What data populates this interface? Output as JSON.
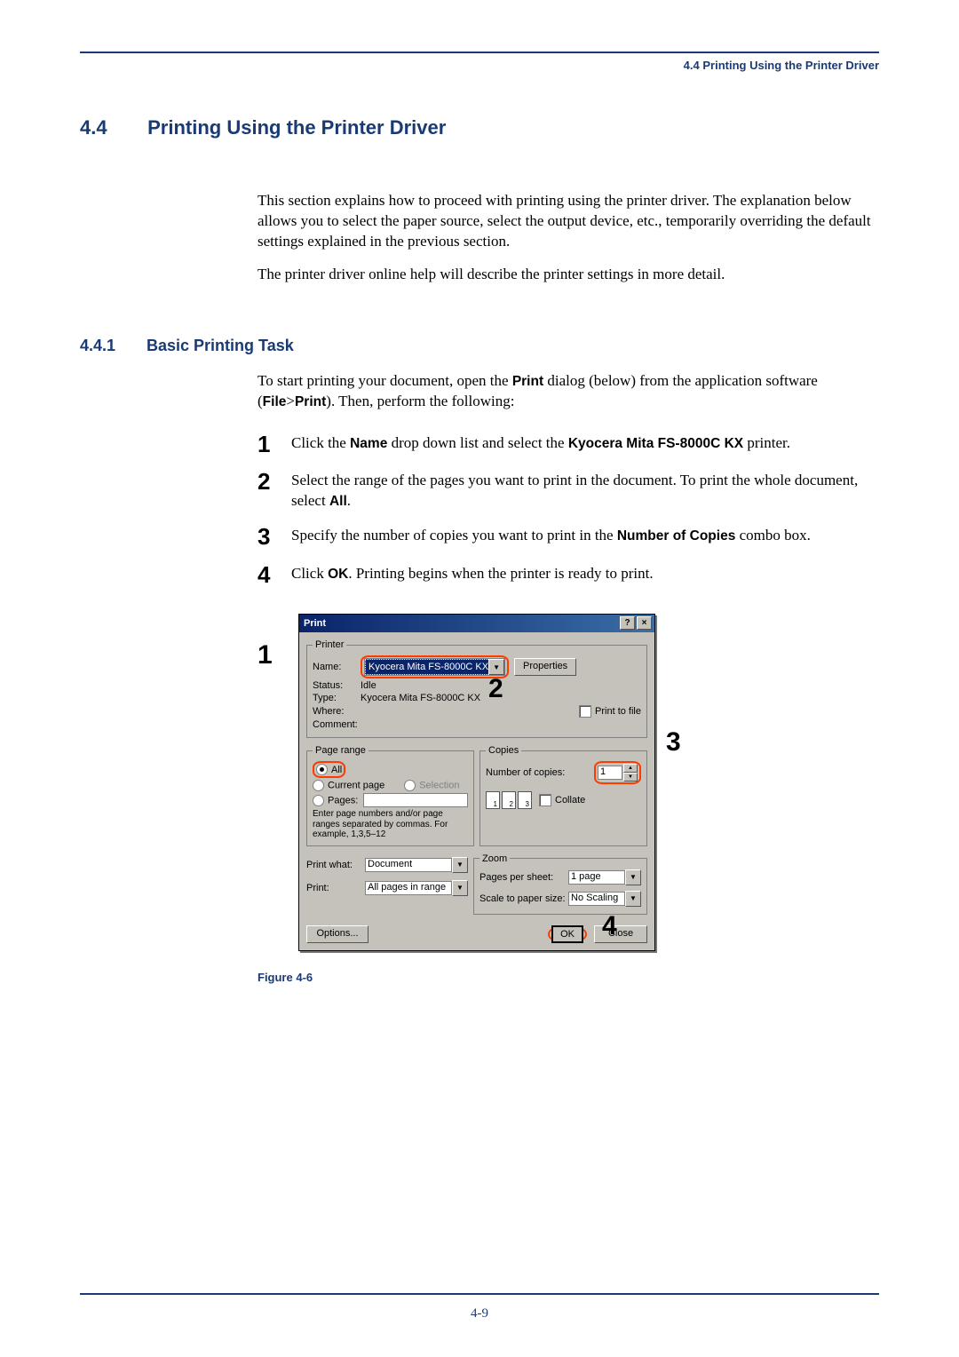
{
  "header_link": "4.4 Printing Using the Printer Driver",
  "section": {
    "number": "4.4",
    "title": "Printing Using the Printer Driver"
  },
  "intro": {
    "p1": "This section explains how to proceed with printing using the printer driver. The explanation below allows you to select the paper source, select the output device, etc., temporarily overriding the default settings explained in the previous section.",
    "p2": "The printer driver online help will describe the printer settings in more detail."
  },
  "subsection": {
    "number": "4.4.1",
    "title": "Basic Printing Task"
  },
  "sub_intro": {
    "pre": "To start printing your document, open the ",
    "b1": "Print",
    "mid1": " dialog (below) from the application software (",
    "b2": "File",
    "gt": ">",
    "b3": "Print",
    "post": "). Then, perform the following:"
  },
  "steps": [
    {
      "n": "1",
      "pre": "Click the ",
      "b1": "Name",
      "mid": " drop down list and select the ",
      "b2": "Kyocera Mita FS-8000C KX",
      "post": " printer."
    },
    {
      "n": "2",
      "pre": "Select the range of the pages you want to print in the document. To print the whole document, select ",
      "b1": "All",
      "post": "."
    },
    {
      "n": "3",
      "pre": "Specify the number of copies you want to print in the ",
      "b1": "Number of Copies",
      "post": " combo box."
    },
    {
      "n": "4",
      "pre": "Click ",
      "b1": "OK",
      "post": ". Printing begins when the printer is ready to print."
    }
  ],
  "dialog": {
    "title": "Print",
    "help": "?",
    "close": "×",
    "printer": {
      "legend": "Printer",
      "name_label": "Name:",
      "name_value": "Kyocera Mita FS-8000C KX",
      "properties": "Properties",
      "status_label": "Status:",
      "status_value": "Idle",
      "type_label": "Type:",
      "type_value": "Kyocera Mita FS-8000C KX",
      "where_label": "Where:",
      "where_value": "",
      "comment_label": "Comment:",
      "comment_value": "",
      "print_to_file": "Print to file"
    },
    "page_range": {
      "legend": "Page range",
      "all": "All",
      "current": "Current page",
      "selection": "Selection",
      "pages": "Pages:",
      "hint": "Enter page numbers and/or page ranges separated by commas. For example, 1,3,5–12"
    },
    "copies": {
      "legend": "Copies",
      "num_label": "Number of copies:",
      "num_value": "1",
      "collate": "Collate"
    },
    "zoom": {
      "legend": "Zoom",
      "pps_label": "Pages per sheet:",
      "pps_value": "1 page",
      "scale_label": "Scale to paper size:",
      "scale_value": "No Scaling"
    },
    "print_what_label": "Print what:",
    "print_what_value": "Document",
    "print_label": "Print:",
    "print_value": "All pages in range",
    "options": "Options...",
    "ok": "OK",
    "close_btn": "Close"
  },
  "callouts": {
    "c1": "1",
    "c2": "2",
    "c3": "3",
    "c4": "4"
  },
  "figure_caption": "Figure 4-6",
  "page_number": "4-9"
}
